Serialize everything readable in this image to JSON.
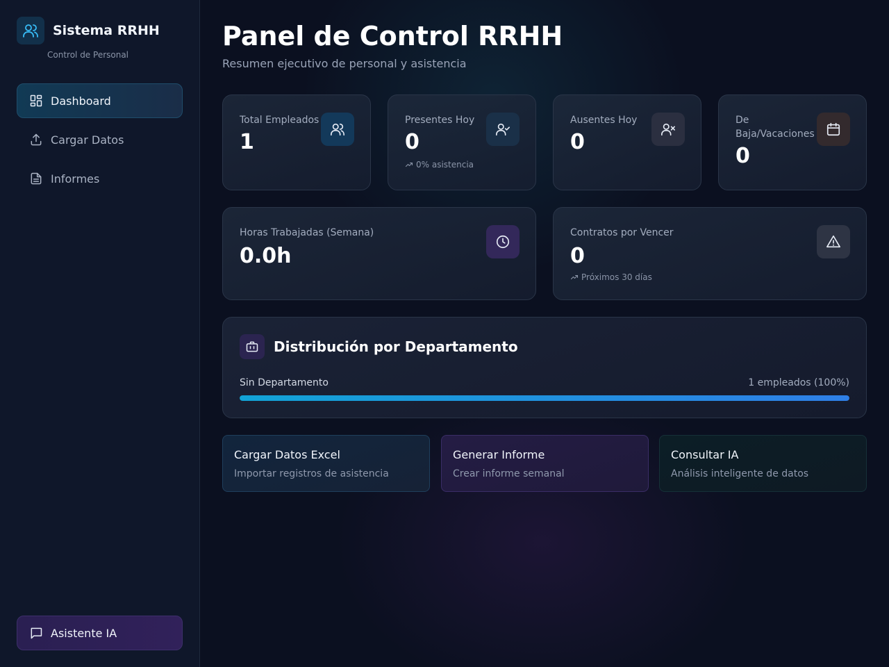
{
  "sidebar": {
    "brand_title": "Sistema RRHH",
    "brand_subtitle": "Control de Personal",
    "items": [
      {
        "label": "Dashboard",
        "icon": "dashboard-icon",
        "active": true
      },
      {
        "label": "Cargar Datos",
        "icon": "upload-icon",
        "active": false
      },
      {
        "label": "Informes",
        "icon": "document-icon",
        "active": false
      }
    ],
    "assistant_label": "Asistente IA"
  },
  "header": {
    "title": "Panel de Control RRHH",
    "subtitle": "Resumen ejecutivo de personal y asistencia"
  },
  "stats": {
    "total": {
      "label": "Total Empleados",
      "value": "1",
      "icon": "users-icon"
    },
    "present": {
      "label": "Presentes Hoy",
      "value": "0",
      "note": "0% asistencia",
      "icon": "user-check-icon"
    },
    "absent": {
      "label": "Ausentes Hoy",
      "value": "0",
      "icon": "user-x-icon"
    },
    "leave": {
      "label": "De Baja/Vacaciones",
      "value": "0",
      "icon": "calendar-icon"
    },
    "hours": {
      "label": "Horas Trabajadas (Semana)",
      "value": "0.0h",
      "icon": "clock-icon"
    },
    "contracts": {
      "label": "Contratos por Vencer",
      "value": "0",
      "note": "Próximos 30 días",
      "icon": "warning-icon"
    }
  },
  "departments": {
    "title": "Distribución por Departamento",
    "icon": "briefcase-icon",
    "rows": [
      {
        "name": "Sin Departamento",
        "value_text": "1 empleados (100%)",
        "percent": 100
      }
    ]
  },
  "actions": [
    {
      "title": "Cargar Datos Excel",
      "subtitle": "Importar registros de asistencia"
    },
    {
      "title": "Generar Informe",
      "subtitle": "Crear informe semanal"
    },
    {
      "title": "Consultar IA",
      "subtitle": "Análisis inteligente de datos"
    }
  ],
  "colors": {
    "accent_blue": "#12a3d6",
    "accent_purple": "#31215a",
    "background": "#0b1020"
  }
}
